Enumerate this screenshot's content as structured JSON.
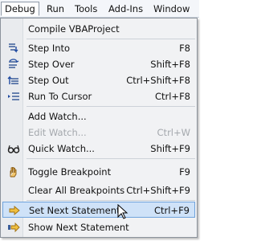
{
  "menubar": {
    "items": [
      {
        "label": "Debug"
      },
      {
        "label": "Run"
      },
      {
        "label": "Tools"
      },
      {
        "label": "Add-Ins"
      },
      {
        "label": "Window"
      }
    ]
  },
  "menu": {
    "items": [
      {
        "label": "Compile VBAProject",
        "shortcut": ""
      },
      {
        "label": "Step Into",
        "shortcut": "F8",
        "icon": "step-into-icon"
      },
      {
        "label": "Step Over",
        "shortcut": "Shift+F8",
        "icon": "step-over-icon"
      },
      {
        "label": "Step Out",
        "shortcut": "Ctrl+Shift+F8",
        "icon": "step-out-icon"
      },
      {
        "label": "Run To Cursor",
        "shortcut": "Ctrl+F8",
        "icon": "run-to-cursor-icon"
      },
      {
        "label": "Add Watch...",
        "shortcut": ""
      },
      {
        "label": "Edit Watch...",
        "shortcut": "Ctrl+W",
        "disabled": true
      },
      {
        "label": "Quick Watch...",
        "shortcut": "Shift+F9",
        "icon": "glasses-icon"
      },
      {
        "label": "Toggle Breakpoint",
        "shortcut": "F9",
        "icon": "hand-icon"
      },
      {
        "label": "Clear All Breakpoints",
        "shortcut": "Ctrl+Shift+F9"
      },
      {
        "label": "Set Next Statement",
        "shortcut": "Ctrl+F9",
        "icon": "arrow-right-icon",
        "highlighted": true
      },
      {
        "label": "Show Next Statement",
        "shortcut": "",
        "icon": "arrow-show-icon"
      }
    ]
  },
  "colors": {
    "highlight_bg": "#cfe2f8",
    "highlight_border": "#6fa3dc",
    "disabled_text": "#a4a8ad"
  }
}
